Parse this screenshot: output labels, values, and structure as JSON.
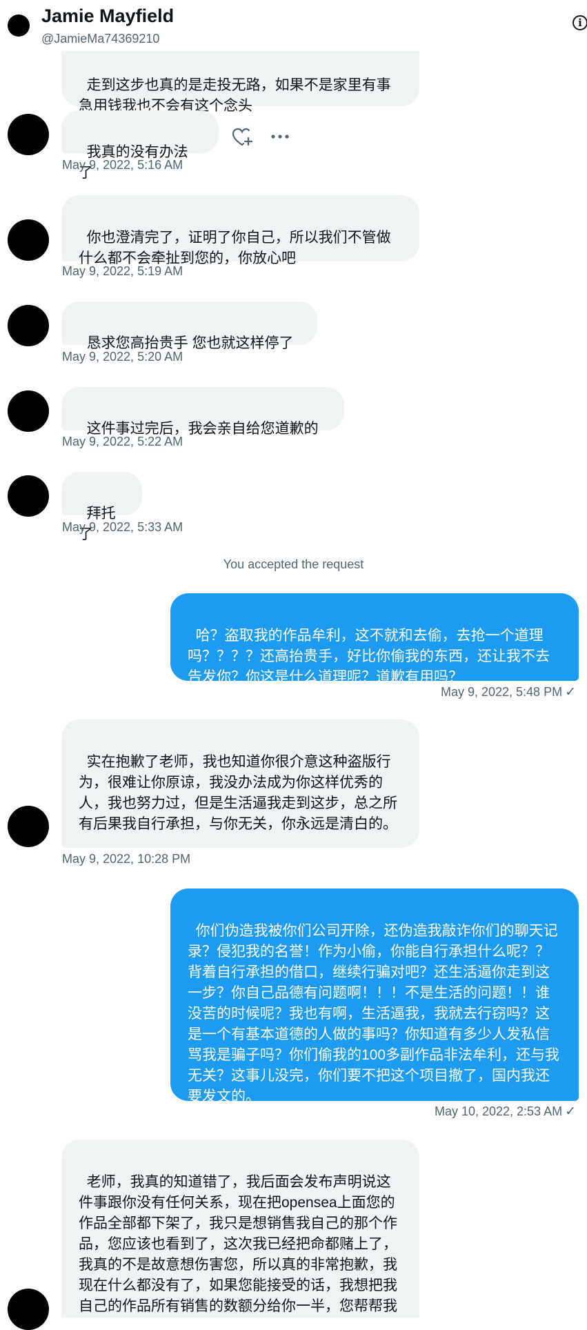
{
  "header": {
    "name": "Jamie Mayfield",
    "handle": "@JamieMa74369210"
  },
  "messages": [
    {
      "id": "m0",
      "text": "走到这步也真的是走投无路，如果不是家里有事急用钱我也不会有这个念头"
    },
    {
      "id": "m1",
      "text": "我真的没有办法了",
      "time": "May 9, 2022, 5:16 AM"
    },
    {
      "id": "m2",
      "text": "你也澄清完了，证明了你自己，所以我们不管做什么都不会牵扯到您的，你放心吧",
      "time": "May 9, 2022, 5:19 AM"
    },
    {
      "id": "m3",
      "text": "恳求您高抬贵手 您也就这样停了",
      "time": "May 9, 2022, 5:20 AM"
    },
    {
      "id": "m4",
      "text": "这件事过完后，我会亲自给您道歉的",
      "time": "May 9, 2022, 5:22 AM"
    },
    {
      "id": "m5",
      "text": "拜托了",
      "time": "May 9, 2022, 5:33 AM"
    },
    {
      "id": "m6",
      "text": "哈？盗取我的作品牟利，这不就和去偷，去抢一个道理吗？？？？还高抬贵手，好比你偷我的东西，还让我不去告发你？你这是什么道理呢？道歉有用吗？",
      "time": "May 9, 2022, 5:48 PM"
    },
    {
      "id": "m7",
      "text": "实在抱歉了老师，我也知道你很介意这种盗版行为，很难让你原谅，我没办法成为你这样优秀的人，我也努力过，但是生活逼我走到这步，总之所有后果我自行承担，与你无关，你永远是清白的。",
      "time": "May 9, 2022, 10:28 PM"
    },
    {
      "id": "m8",
      "text": "你们伪造我被你们公司开除，还伪造我敲诈你们的聊天记录？侵犯我的名誉！作为小偷，你能自行承担什么呢？？背着自行承担的借口，继续行骗对吧？还生活逼你走到这一步？你自己品德有问题啊！！！不是生活的问题！！谁没苦的时候呢？我也有啊，生活逼我，我就去行窃吗？这是一个有基本道德的人做的事吗？你知道有多少人发私信骂我是骗子吗？你们偷我的100多副作品非法牟利，还与我无关？这事儿没完，你们要不把这个项目撤了，国内我还要发文的。",
      "time": "May 10, 2022, 2:53 AM"
    },
    {
      "id": "m9",
      "text": "老师，我真的知道错了，我后面会发布声明说这件事跟你没有任何关系，现在把opensea上面您的作品全部都下架了，我只是想销售我自己的那个作品，您应该也看到了，这次我已经把命都赌上了，我真的不是故意想伤害您，所以真的非常抱歉，我现在什么都没有了，如果您能接受的话，我想把我自己的作品所有销售的数额分给你一半，您帮帮我吧"
    }
  ],
  "system_note": "You accepted the request",
  "sent_check": "✓",
  "icons": {
    "info": "info-icon",
    "react": "add-reaction-icon",
    "more": "more-options-icon"
  },
  "colors": {
    "outgoing_bubble": "#1d9bf0",
    "incoming_bubble": "#eff3f4",
    "secondary_text": "#536471"
  }
}
